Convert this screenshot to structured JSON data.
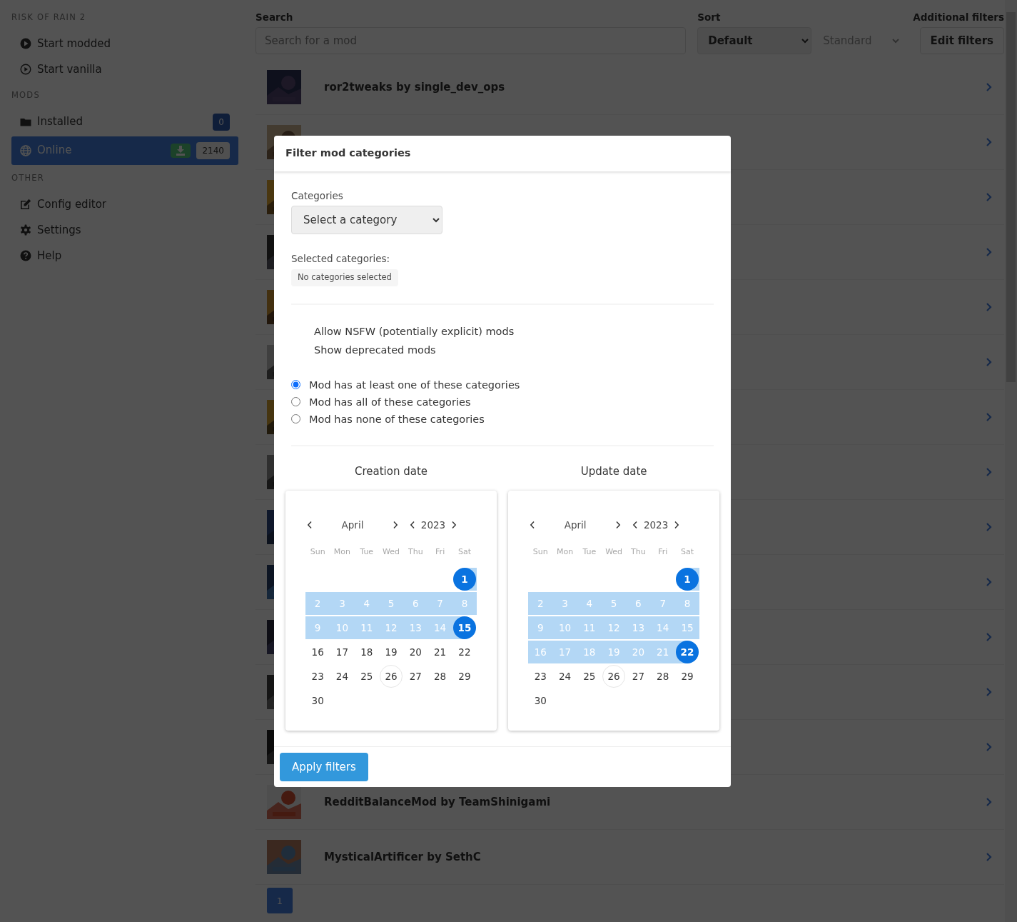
{
  "sidebar": {
    "sections": [
      {
        "title": "RISK OF RAIN 2",
        "items": [
          {
            "label": "Start modded",
            "selected": false
          },
          {
            "label": "Start vanilla",
            "selected": false
          }
        ]
      },
      {
        "title": "MODS",
        "items": [
          {
            "label": "Installed",
            "selected": false,
            "download": false,
            "count": "0"
          },
          {
            "label": "Online",
            "selected": true,
            "download": true,
            "count": "2140"
          }
        ]
      },
      {
        "title": "OTHER",
        "items": [
          {
            "label": "Config editor",
            "selected": false
          },
          {
            "label": "Settings",
            "selected": false
          },
          {
            "label": "Help",
            "selected": false
          }
        ]
      }
    ]
  },
  "toolbar": {
    "search_label": "Search",
    "search_placeholder": "Search for a mod",
    "sort_label": "Sort",
    "sort_value": "Default",
    "direction_value": "Standard",
    "filters_label": "Additional filters",
    "filters_button": "Edit filters"
  },
  "mods": [
    {
      "thumbnail": {
        "kind": "picture"
      },
      "name": "ror2tweaks by single_dev_ops"
    },
    {
      "thumbnail": {
        "kind": "picture"
      }
    },
    {
      "thumbnail": {
        "kind": "picture"
      }
    },
    {
      "thumbnail": {
        "kind": "picture"
      }
    },
    {
      "thumbnail": {
        "kind": "picture"
      }
    },
    {
      "thumbnail": {
        "kind": "picture"
      }
    },
    {
      "thumbnail": {
        "kind": "picture"
      }
    },
    {
      "thumbnail": {
        "kind": "picture"
      }
    },
    {
      "thumbnail": {
        "kind": "picture"
      }
    },
    {
      "thumbnail": {
        "kind": "picture"
      }
    },
    {
      "thumbnail": {
        "kind": "picture"
      }
    },
    {
      "thumbnail": {
        "kind": "picture"
      }
    },
    {
      "thumbnail": {
        "kind": "picture"
      }
    },
    {
      "thumbnail": {
        "kind": "picture"
      },
      "name": "RedditBalanceMod by TeamShinigami"
    },
    {
      "thumbnail": {
        "kind": "picture"
      },
      "name": "MysticalArtificer by SethC"
    }
  ],
  "pagination": [
    {
      "label": "1",
      "selected": true
    }
  ],
  "modal": {
    "title": "Filter mod categories",
    "categories_label": "Categories",
    "category_select": "Select a category",
    "selected_label": "Selected categories:",
    "selected_tag": "No categories selected",
    "toggles": [
      "Allow NSFW (potentially explicit) mods",
      "Show deprecated mods"
    ],
    "match_options": [
      {
        "label": "Mod has at least one of these categories",
        "selected": true
      },
      {
        "label": "Mod has all of these categories",
        "selected": false
      },
      {
        "label": "Mod has none of these categories",
        "selected": false
      }
    ],
    "calendars": [
      {
        "title": "Creation date",
        "month": "April",
        "year": "2023",
        "weekdays": [
          "Sun",
          "Mon",
          "Tue",
          "Wed",
          "Thu",
          "Fri",
          "Sat"
        ],
        "weeks": [
          [
            {
              "day": "1",
              "selected": true,
              "in_range": true,
              "today": false
            }
          ],
          [
            {
              "day": "2",
              "selected": false,
              "in_range": true,
              "today": false
            },
            {
              "day": "3",
              "selected": false,
              "in_range": true,
              "today": false
            },
            {
              "day": "4",
              "selected": false,
              "in_range": true,
              "today": false
            },
            {
              "day": "5",
              "selected": false,
              "in_range": true,
              "today": false
            },
            {
              "day": "6",
              "selected": false,
              "in_range": true,
              "today": false
            },
            {
              "day": "7",
              "selected": false,
              "in_range": true,
              "today": false
            },
            {
              "day": "8",
              "selected": false,
              "in_range": true,
              "today": false
            }
          ],
          [
            {
              "day": "9",
              "selected": false,
              "in_range": true,
              "today": false
            },
            {
              "day": "10",
              "selected": false,
              "in_range": true,
              "today": false
            },
            {
              "day": "11",
              "selected": false,
              "in_range": true,
              "today": false
            },
            {
              "day": "12",
              "selected": false,
              "in_range": true,
              "today": false
            },
            {
              "day": "13",
              "selected": false,
              "in_range": true,
              "today": false
            },
            {
              "day": "14",
              "selected": false,
              "in_range": true,
              "today": false
            },
            {
              "day": "15",
              "selected": true,
              "in_range": true,
              "today": false
            }
          ],
          [
            {
              "day": "16",
              "selected": false,
              "in_range": false,
              "today": false
            },
            {
              "day": "17",
              "selected": false,
              "in_range": false,
              "today": false
            },
            {
              "day": "18",
              "selected": false,
              "in_range": false,
              "today": false
            },
            {
              "day": "19",
              "selected": false,
              "in_range": false,
              "today": false
            },
            {
              "day": "20",
              "selected": false,
              "in_range": false,
              "today": false
            },
            {
              "day": "21",
              "selected": false,
              "in_range": false,
              "today": false
            },
            {
              "day": "22",
              "selected": false,
              "in_range": false,
              "today": false
            }
          ],
          [
            {
              "day": "23",
              "selected": false,
              "in_range": false,
              "today": false
            },
            {
              "day": "24",
              "selected": false,
              "in_range": false,
              "today": false
            },
            {
              "day": "25",
              "selected": false,
              "in_range": false,
              "today": false
            },
            {
              "day": "26",
              "selected": false,
              "in_range": false,
              "today": true
            },
            {
              "day": "27",
              "selected": false,
              "in_range": false,
              "today": false
            },
            {
              "day": "28",
              "selected": false,
              "in_range": false,
              "today": false
            },
            {
              "day": "29",
              "selected": false,
              "in_range": false,
              "today": false
            }
          ],
          [
            {
              "day": "30",
              "selected": false,
              "in_range": false,
              "today": false
            }
          ]
        ]
      },
      {
        "title": "Update date",
        "month": "April",
        "year": "2023",
        "weekdays": [
          "Sun",
          "Mon",
          "Tue",
          "Wed",
          "Thu",
          "Fri",
          "Sat"
        ],
        "weeks": [
          [
            {
              "day": "1",
              "selected": true,
              "in_range": true,
              "today": false
            }
          ],
          [
            {
              "day": "2",
              "selected": false,
              "in_range": true,
              "today": false
            },
            {
              "day": "3",
              "selected": false,
              "in_range": true,
              "today": false
            },
            {
              "day": "4",
              "selected": false,
              "in_range": true,
              "today": false
            },
            {
              "day": "5",
              "selected": false,
              "in_range": true,
              "today": false
            },
            {
              "day": "6",
              "selected": false,
              "in_range": true,
              "today": false
            },
            {
              "day": "7",
              "selected": false,
              "in_range": true,
              "today": false
            },
            {
              "day": "8",
              "selected": false,
              "in_range": true,
              "today": false
            }
          ],
          [
            {
              "day": "9",
              "selected": false,
              "in_range": true,
              "today": false
            },
            {
              "day": "10",
              "selected": false,
              "in_range": true,
              "today": false
            },
            {
              "day": "11",
              "selected": false,
              "in_range": true,
              "today": false
            },
            {
              "day": "12",
              "selected": false,
              "in_range": true,
              "today": false
            },
            {
              "day": "13",
              "selected": false,
              "in_range": true,
              "today": false
            },
            {
              "day": "14",
              "selected": false,
              "in_range": true,
              "today": false
            },
            {
              "day": "15",
              "selected": false,
              "in_range": true,
              "today": false
            }
          ],
          [
            {
              "day": "16",
              "selected": false,
              "in_range": true,
              "today": false
            },
            {
              "day": "17",
              "selected": false,
              "in_range": true,
              "today": false
            },
            {
              "day": "18",
              "selected": false,
              "in_range": true,
              "today": false
            },
            {
              "day": "19",
              "selected": false,
              "in_range": true,
              "today": false
            },
            {
              "day": "20",
              "selected": false,
              "in_range": true,
              "today": false
            },
            {
              "day": "21",
              "selected": false,
              "in_range": true,
              "today": false
            },
            {
              "day": "22",
              "selected": true,
              "in_range": true,
              "today": false
            }
          ],
          [
            {
              "day": "23",
              "selected": false,
              "in_range": false,
              "today": false
            },
            {
              "day": "24",
              "selected": false,
              "in_range": false,
              "today": false
            },
            {
              "day": "25",
              "selected": false,
              "in_range": false,
              "today": false
            },
            {
              "day": "26",
              "selected": false,
              "in_range": false,
              "today": true
            },
            {
              "day": "27",
              "selected": false,
              "in_range": false,
              "today": false
            },
            {
              "day": "28",
              "selected": false,
              "in_range": false,
              "today": false
            },
            {
              "day": "29",
              "selected": false,
              "in_range": false,
              "today": false
            }
          ],
          [
            {
              "day": "30",
              "selected": false,
              "in_range": false,
              "today": false
            }
          ]
        ]
      }
    ],
    "apply_button": "Apply filters"
  }
}
